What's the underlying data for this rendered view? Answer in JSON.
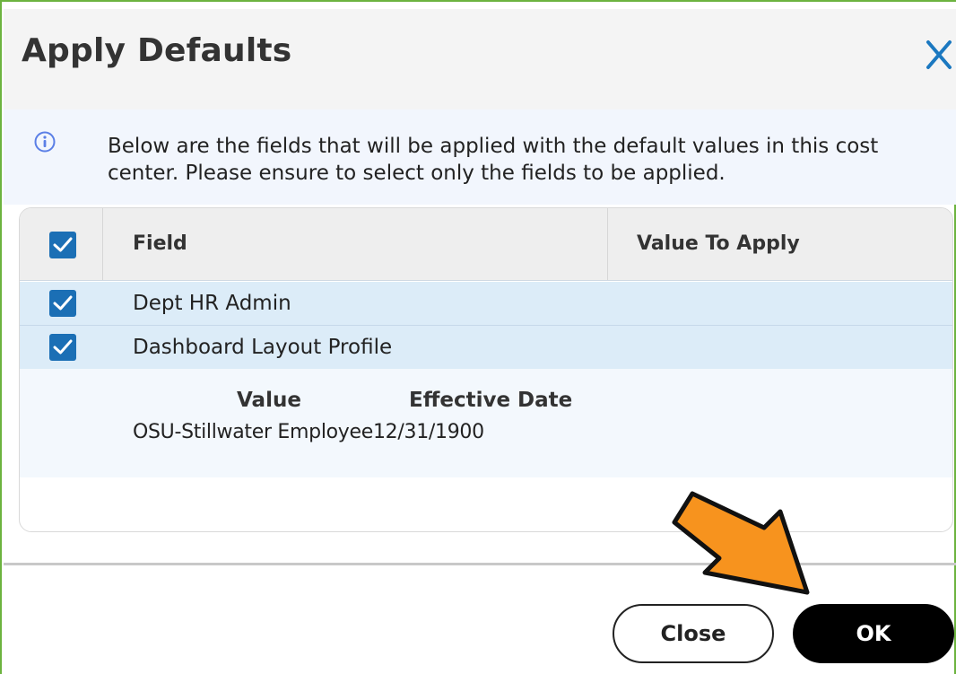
{
  "dialog": {
    "title": "Apply Defaults",
    "close_icon": "close-x-icon",
    "accent_color": "#1b78c0"
  },
  "info": {
    "icon": "info-icon",
    "message": "Below are the fields that will be applied with the default values in this cost center. Please ensure to select only the fields to be applied."
  },
  "table": {
    "select_all_checked": true,
    "columns": [
      "Field",
      "Value To Apply"
    ],
    "rows": [
      {
        "field": "Dept HR Admin",
        "checked": true
      },
      {
        "field": "Dashboard Layout Profile",
        "checked": true
      }
    ],
    "detail": {
      "headers": [
        "Value",
        "Effective Date"
      ],
      "value": "OSU-Stillwater Employee",
      "effective_date": "12/31/1900"
    }
  },
  "footer": {
    "close_label": "Close",
    "ok_label": "OK"
  },
  "annotation": {
    "icon": "orange-arrow-pointer",
    "color": "#f7931e"
  }
}
